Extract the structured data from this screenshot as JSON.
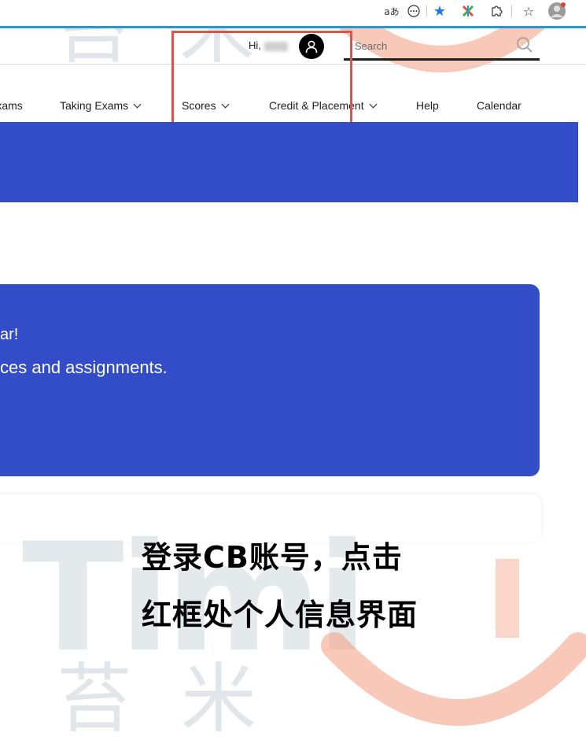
{
  "browser_toolbar": {
    "translate_icon": "aあ",
    "more_icon": "⋯",
    "bookmark_icon": "★",
    "extension_icon": "✱",
    "puzzle_icon": "⧉",
    "favorites_icon": "☆",
    "accent_color": "#1e9bd7"
  },
  "header": {
    "greeting": "Hi,",
    "search": {
      "placeholder": "Search"
    }
  },
  "nav": {
    "items": [
      {
        "label": "Exams"
      },
      {
        "label": "Taking Exams"
      },
      {
        "label": "Scores"
      },
      {
        "label": "Credit & Placement"
      },
      {
        "label": "Help"
      },
      {
        "label": "Calendar"
      }
    ]
  },
  "card": {
    "line1": "ar!",
    "line2": "ces and assignments."
  },
  "watermark": {
    "chars_top": [
      "苔",
      "米"
    ],
    "chars_bottom": [
      "苔",
      "米"
    ],
    "latin": "Timi"
  },
  "instruction": {
    "line1": "登录CB账号，点击",
    "line2": "红框处个人信息界面"
  },
  "colors": {
    "brand_blue": "#324dc7",
    "highlight_red": "#e0524c",
    "watermark_orange": "#f4a38b"
  }
}
